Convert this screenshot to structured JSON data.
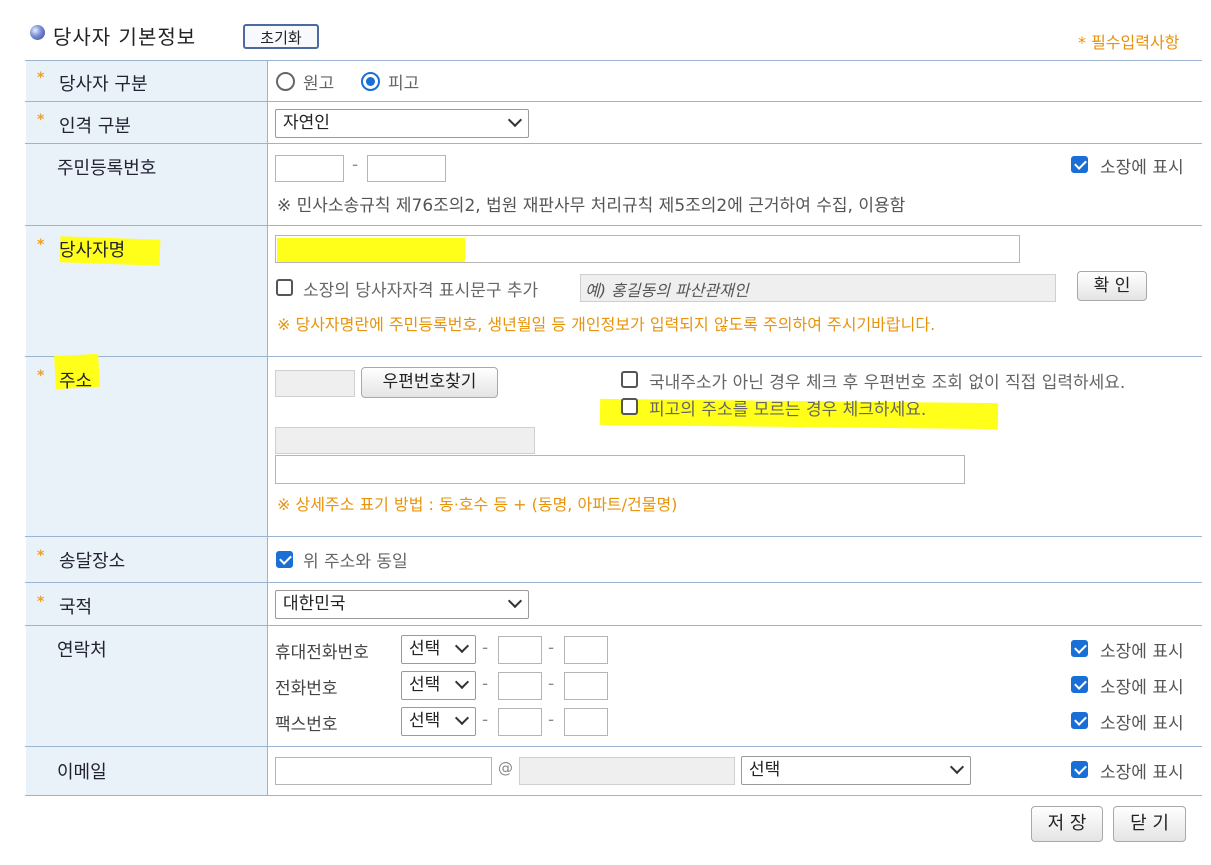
{
  "header": {
    "title": "당사자 기본정보",
    "reset_label": "초기화",
    "required_note": "* 필수입력사항"
  },
  "colors": {
    "accent": "#1a6fd6",
    "required": "#e8930c",
    "highlight": "#ffff1a",
    "label_bg": "#e9f1f9"
  },
  "party_type": {
    "label": "당사자 구분",
    "options": [
      "원고",
      "피고"
    ],
    "selected": "피고"
  },
  "person_type": {
    "label": "인격 구분",
    "value": "자연인"
  },
  "rrn": {
    "label": "주민등록번호",
    "dash": "-",
    "show_label": "소장에 표시",
    "note": "※ 민사소송규칙 제76조의2, 법원 재판사무 처리규칙 제5조의2에 근거하여 수집, 이용함"
  },
  "party_name": {
    "label": "당사자명",
    "qualification_label": "소장의 당사자자격 표시문구 추가",
    "qualification_placeholder": "예) 홍길동의 파산관재인",
    "confirm_label": "확 인",
    "warning": "※ 당사자명란에 주민등록번호, 생년월일 등 개인정보가 입력되지 않도록 주의하여 주시기바랍니다."
  },
  "address": {
    "label": "주소",
    "postcode_button": "우편번호찾기",
    "foreign_check": "국내주소가 아닌 경우 체크 후 우편번호 조회 없이 직접 입력하세요.",
    "unknown_check": "피고의 주소를 모르는 경우 체크하세요.",
    "note": "※ 상세주소 표기 방법 : 동·호수 등 + (동명, 아파트/건물명)"
  },
  "delivery": {
    "label": "송달장소",
    "same_label": "위 주소와 동일"
  },
  "nationality": {
    "label": "국적",
    "value": "대한민국"
  },
  "contact": {
    "label": "연락처",
    "rows": [
      {
        "label": "휴대전화번호",
        "select": "선택",
        "show_label": "소장에 표시"
      },
      {
        "label": "전화번호",
        "select": "선택",
        "show_label": "소장에 표시"
      },
      {
        "label": "팩스번호",
        "select": "선택",
        "show_label": "소장에 표시"
      }
    ],
    "dash": "-"
  },
  "email": {
    "label": "이메일",
    "at": "@",
    "domain_select": "선택",
    "show_label": "소장에 표시"
  },
  "footer": {
    "save_label": "저 장",
    "close_label": "닫 기"
  }
}
